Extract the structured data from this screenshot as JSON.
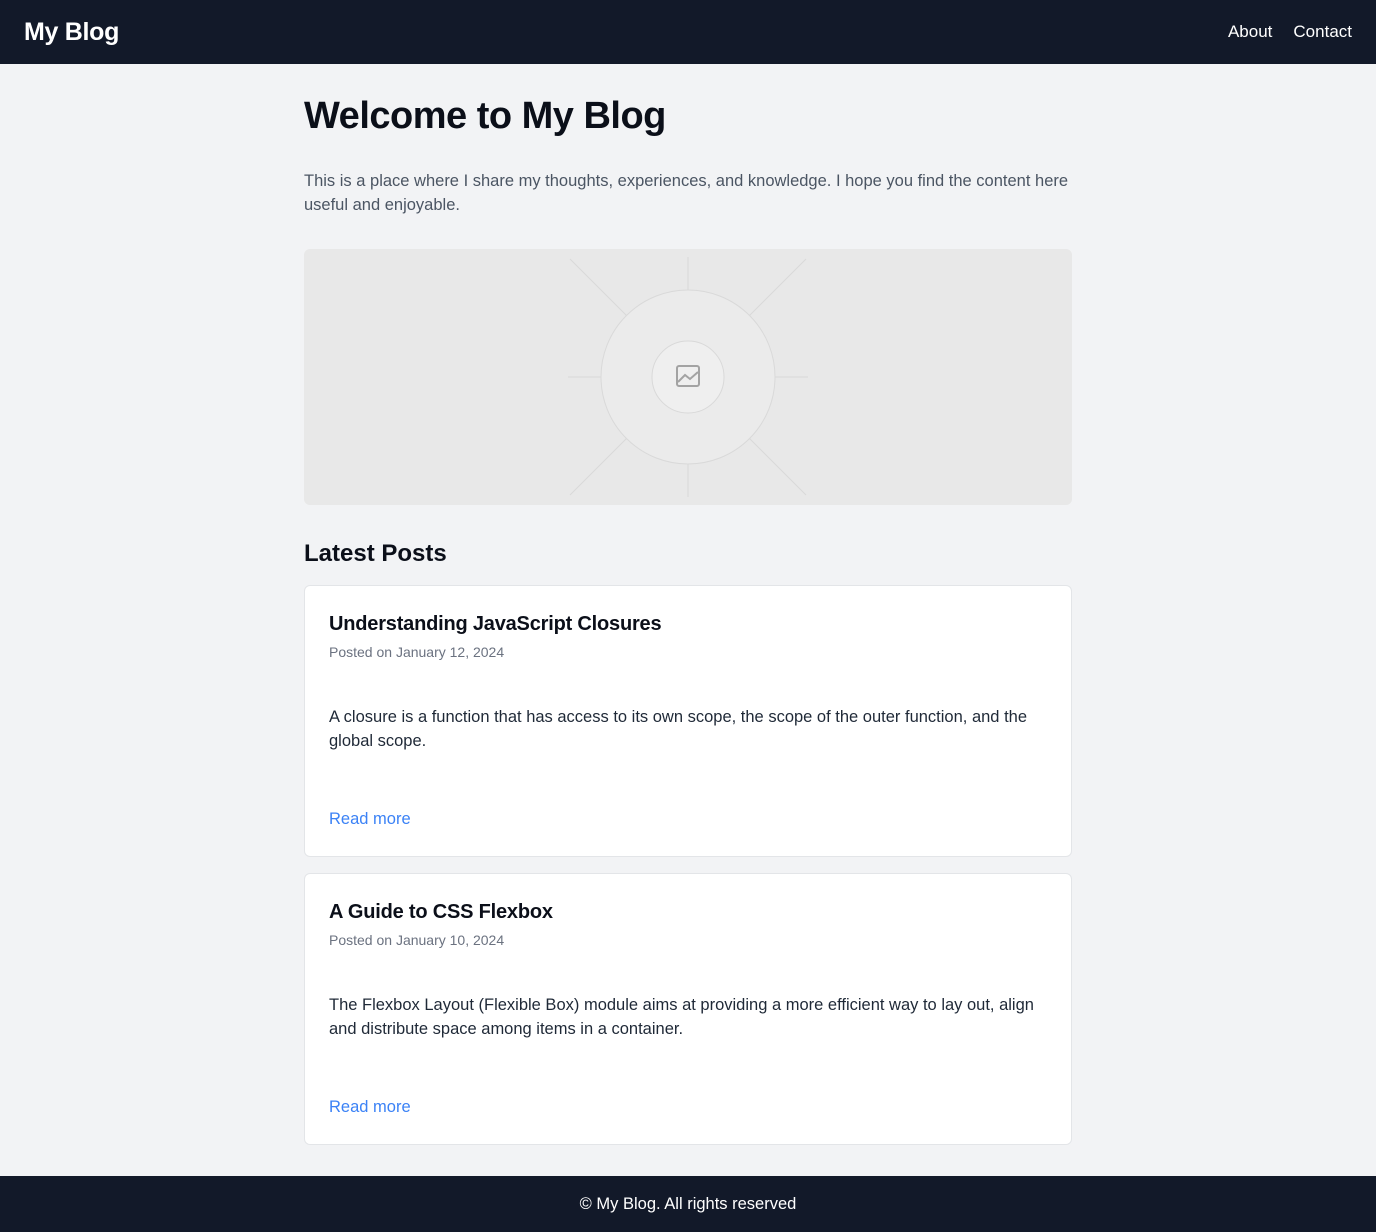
{
  "header": {
    "brand": "My Blog",
    "nav": [
      {
        "label": "About"
      },
      {
        "label": "Contact"
      }
    ]
  },
  "main": {
    "title": "Welcome to My Blog",
    "intro": "This is a place where I share my thoughts, experiences, and knowledge. I hope you find the content here useful and enjoyable.",
    "hero_image_icon": "image-icon",
    "latest_posts_title": "Latest Posts",
    "posts": [
      {
        "title": "Understanding JavaScript Closures",
        "date": "Posted on January 12, 2024",
        "excerpt": "A closure is a function that has access to its own scope, the scope of the outer function, and the global scope.",
        "read_more": "Read more"
      },
      {
        "title": "A Guide to CSS Flexbox",
        "date": "Posted on January 10, 2024",
        "excerpt": "The Flexbox Layout (Flexible Box) module aims at providing a more efficient way to lay out, align and distribute space among items in a container.",
        "read_more": "Read more"
      }
    ]
  },
  "footer": {
    "text": "© My Blog. All rights reserved"
  },
  "colors": {
    "header_bg": "#121929",
    "page_bg": "#f2f3f5",
    "link": "#3b82f6"
  }
}
